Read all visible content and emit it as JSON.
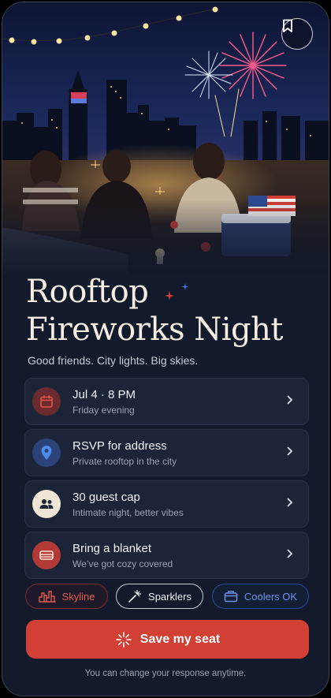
{
  "event": {
    "title_line1": "Rooftop",
    "title_line2": "Fireworks Night",
    "tagline": "Good friends. City lights. Big skies."
  },
  "hero": {
    "bookmark_icon": "bookmark-icon",
    "image": "rooftop-fireworks-photo"
  },
  "details": [
    {
      "icon": "calendar-icon",
      "title": "Jul 4 · 8 PM",
      "subtitle": "Friday evening",
      "accent": "#e0534a"
    },
    {
      "icon": "location-pin-icon",
      "title": "RSVP for address",
      "subtitle": "Private rooftop in the city",
      "accent": "#4c8be8"
    },
    {
      "icon": "people-icon",
      "title": "30 guest cap",
      "subtitle": "Intimate night, better vibes",
      "accent": "#f0e6d6"
    },
    {
      "icon": "blanket-icon",
      "title": "Bring a blanket",
      "subtitle": "We’ve got cozy covered",
      "accent": "#e0534a"
    }
  ],
  "chips": [
    {
      "icon": "skyline-icon",
      "label": "Skyline",
      "color": "#e15a4e"
    },
    {
      "icon": "sparkler-icon",
      "label": "Sparklers",
      "color": "#f1f3f7"
    },
    {
      "icon": "cooler-icon",
      "label": "Coolers OK",
      "color": "#6f93e8"
    }
  ],
  "cta": {
    "label": "Save my seat",
    "icon": "firework-icon",
    "color": "#d23f35"
  },
  "footer_note": "You can change your response anytime."
}
